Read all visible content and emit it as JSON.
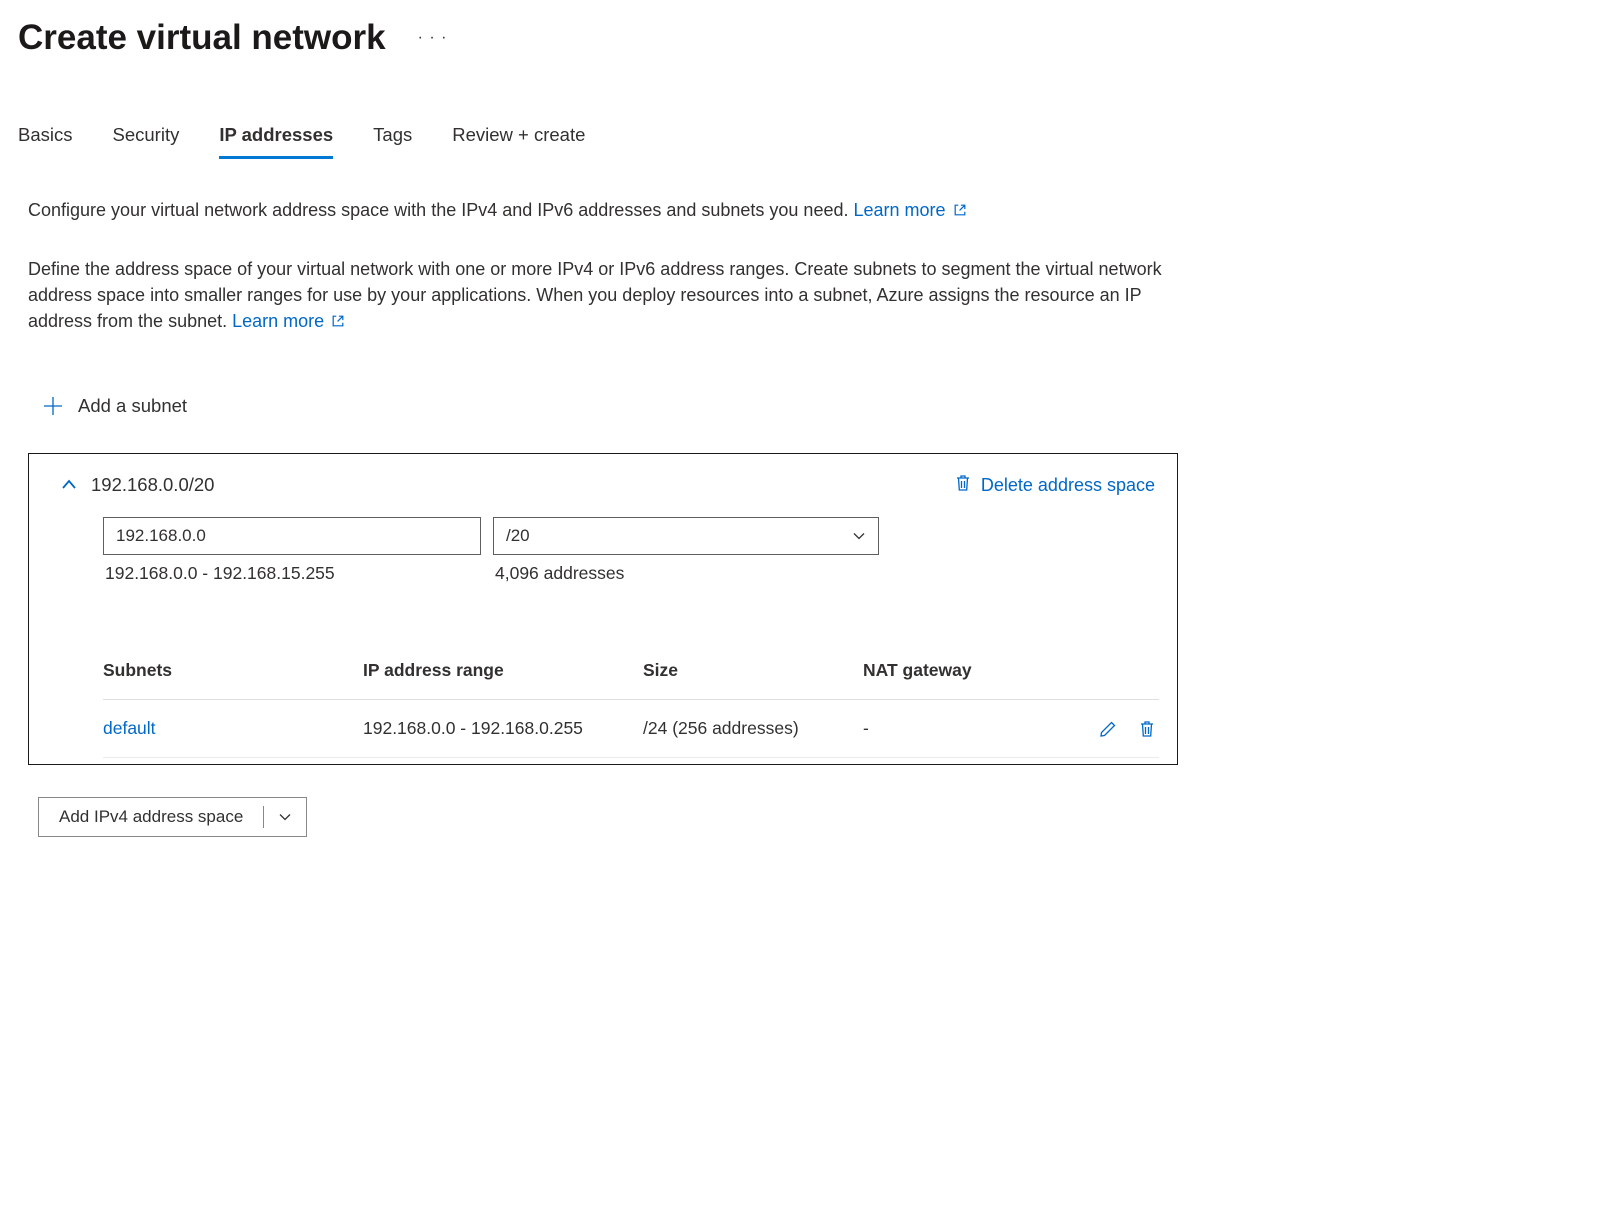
{
  "header": {
    "title": "Create virtual network"
  },
  "tabs": [
    {
      "label": "Basics",
      "active": false
    },
    {
      "label": "Security",
      "active": false
    },
    {
      "label": "IP addresses",
      "active": true
    },
    {
      "label": "Tags",
      "active": false
    },
    {
      "label": "Review + create",
      "active": false
    }
  ],
  "desc1_text": "Configure your virtual network address space with the IPv4 and IPv6 addresses and subnets you need.",
  "desc2_text": "Define the address space of your virtual network with one or more IPv4 or IPv6 address ranges. Create subnets to segment the virtual network address space into smaller ranges for use by your applications. When you deploy resources into a subnet, Azure assigns the resource an IP address from the subnet.",
  "learn_more_label": "Learn more",
  "add_subnet_label": "Add a subnet",
  "address_space": {
    "title": "192.168.0.0/20",
    "delete_label": "Delete address space",
    "ip_value": "192.168.0.0",
    "cidr_value": "/20",
    "range_hint": "192.168.0.0 - 192.168.15.255",
    "count_hint": "4,096 addresses"
  },
  "subnet_table": {
    "headers": {
      "subnets": "Subnets",
      "range": "IP address range",
      "size": "Size",
      "nat": "NAT gateway"
    },
    "rows": [
      {
        "name": "default",
        "range": "192.168.0.0 - 192.168.0.255",
        "size": "/24 (256 addresses)",
        "nat": "-"
      }
    ]
  },
  "add_ipv4_label": "Add IPv4 address space"
}
